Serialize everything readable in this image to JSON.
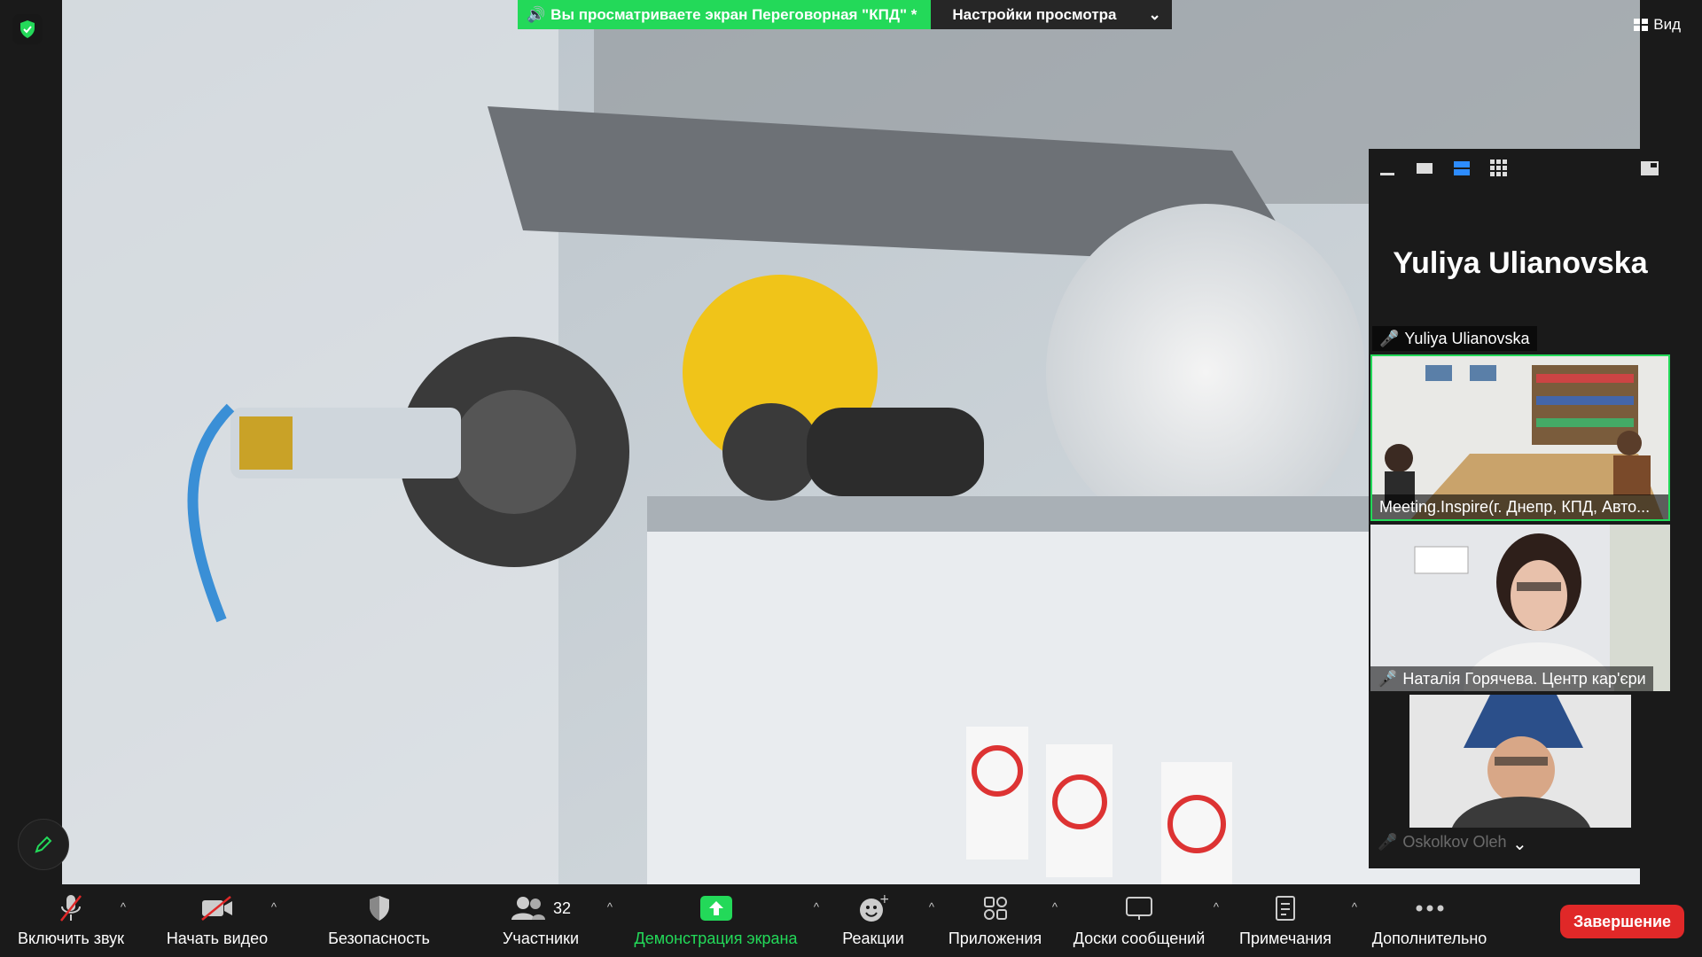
{
  "banner": {
    "sharing_text": "Вы просматриваете экран Переговорная \"КПД\" *",
    "settings_label": "Настройки просмотра"
  },
  "view_label": "Вид",
  "panel": {
    "speaker_name": "Yuliya Ulianovska",
    "participants": [
      {
        "name": "Yuliya Ulianovska",
        "muted": true
      },
      {
        "name": "Meeting.Inspire(г. Днепр, КПД, Авто...",
        "muted": false,
        "active": true
      },
      {
        "name": "Наталія Горячева. Центр кар'єри",
        "muted": true
      },
      {
        "name": "Oskolkov Oleh",
        "muted": true
      }
    ]
  },
  "toolbar": {
    "unmute": "Включить звук",
    "start_video": "Начать видео",
    "security": "Безопасность",
    "participants": "Участники",
    "participants_count": "32",
    "share": "Демонстрация экрана",
    "reactions": "Реакции",
    "apps": "Приложения",
    "whiteboards": "Доски сообщений",
    "notes": "Примечания",
    "more": "Дополнительно",
    "end": "Завершение"
  },
  "colors": {
    "accent_green": "#23d959",
    "end_red": "#e02828",
    "muted_red": "#e02828"
  }
}
